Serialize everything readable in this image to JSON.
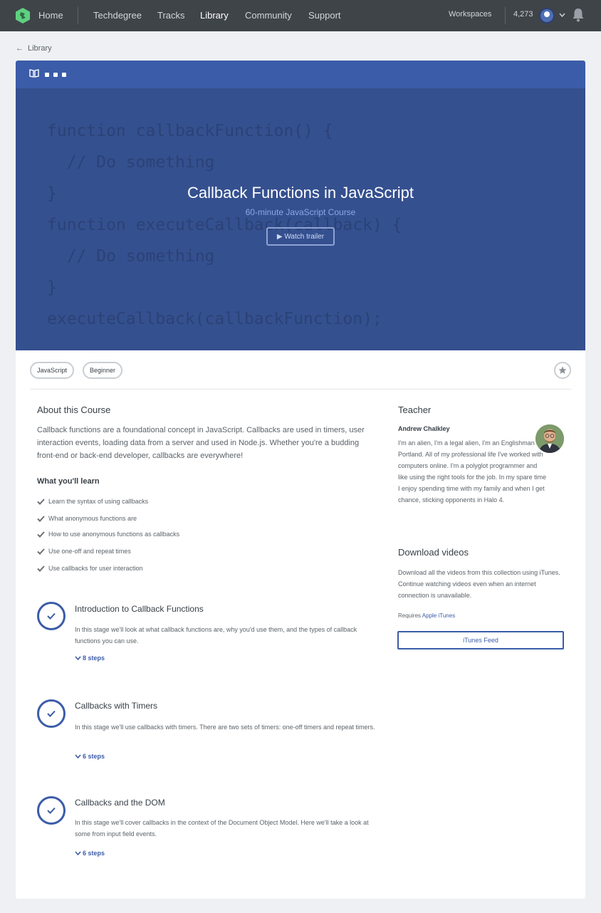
{
  "nav": {
    "links": [
      "Home",
      "Techdegree",
      "Tracks",
      "Library",
      "Community",
      "Support"
    ],
    "workspaces": "Workspaces",
    "points": "4,273"
  },
  "breadcrumb": {
    "label": "Library"
  },
  "hero": {
    "code_lines": [
      "function callbackFunction() {",
      "  // Do something",
      "}",
      "function executeCallback(callback) {",
      "  // Do something",
      "}",
      "executeCallback(callbackFunction);"
    ],
    "title": "Callback Functions in JavaScript",
    "subtitle": "60-minute JavaScript Course",
    "trailer_label": "▶ Watch trailer"
  },
  "tags": [
    "JavaScript",
    "Beginner"
  ],
  "about": {
    "heading": "About this Course",
    "description": "Callback functions are a foundational concept in JavaScript. Callbacks are used in timers, user interaction events, loading data from a server and used in Node.js. Whether you're a budding front-end or back-end developer, callbacks are everywhere!",
    "learn_heading": "What you'll learn",
    "learn_items": [
      "Learn the syntax of using callbacks",
      "What anonymous functions are",
      "How to use anonymous functions as callbacks",
      "Use one-off and repeat times",
      "Use callbacks for user interaction"
    ]
  },
  "stages": [
    {
      "title": "Introduction to Callback Functions",
      "description": "In this stage we'll look at what callback functions are, why you'd use them, and the types of callback functions you can use.",
      "steps": "8 steps"
    },
    {
      "title": "Callbacks with Timers",
      "description": "In this stage we'll use callbacks with timers. There are two sets of timers: one-off timers and repeat timers.",
      "steps": "6 steps"
    },
    {
      "title": "Callbacks and the DOM",
      "description": "In this stage we'll cover callbacks in the context of the Document Object Model. Here we'll take a look at some from input field events.",
      "steps": "6 steps"
    }
  ],
  "teacher": {
    "heading": "Teacher",
    "name": "Andrew Chalkley",
    "bio": "I'm an alien, I'm a legal alien, I'm an Englishman in Portland. All of my professional life I've worked with computers online. I'm a polyglot programmer and like using the right tools for the job. In my spare time I enjoy spending time with my family and when I get chance, sticking opponents in Halo 4."
  },
  "download": {
    "heading": "Download videos",
    "description": "Download all the videos from this collection using iTunes. Continue watching videos even when an internet connection is unavailable.",
    "requires_label": "Requires",
    "requires_link": "Apple iTunes",
    "button_label": "iTunes Feed"
  },
  "colors": {
    "nav_bg": "#3f4449",
    "accent": "#3b5ca8",
    "hero_bg": "#35508f",
    "page_bg": "#eef0f3"
  }
}
